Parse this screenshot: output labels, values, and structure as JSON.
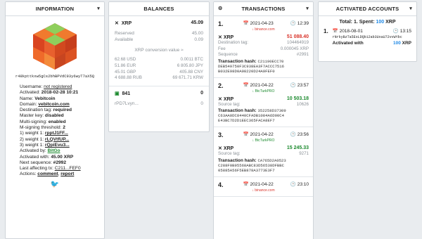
{
  "info": {
    "title": "INFORMATION",
    "address": "r48kpttkxw5gCs2bhBPVdC93y6wyT7aX5Q",
    "lines": [
      {
        "label": "Username: ",
        "value": "not registered",
        "style": "underline"
      },
      {
        "label": "Activated: ",
        "value": "2018-02-28 10:21",
        "style": "bold"
      },
      {
        "label": "Name: ",
        "value": "Vebitcoin",
        "style": "bold"
      },
      {
        "label": "Domain: ",
        "value": "vebitcoin.com",
        "style": "bold-underline"
      },
      {
        "label": "Destination tag: ",
        "value": "required",
        "style": "bold"
      },
      {
        "label": "Master key: ",
        "value": "disabled",
        "style": "bold"
      },
      {
        "label": "Multi-signing: ",
        "value": "enabled",
        "style": "bold"
      },
      {
        "label": "M-signing threshold: ",
        "value": "2",
        "style": "bold"
      },
      {
        "label": "1) weight 1: ",
        "value": "rpptJ1FF...",
        "style": "bold-underline"
      },
      {
        "label": "2) weight 1: ",
        "value": "rLQVtfUP...",
        "style": "bold-underline"
      },
      {
        "label": "3) weight 1: ",
        "value": "rQpiEvu3...",
        "style": "bold-underline"
      },
      {
        "label": "Activated by: ",
        "value": "BitGo",
        "style": "green-underline"
      },
      {
        "label": "Activated with: ",
        "value": "45.00 XRP",
        "style": "bold"
      },
      {
        "label": "Next sequence: ",
        "value": "#2992",
        "style": "bold"
      },
      {
        "label": "Last affecting tx: ",
        "value": "C211...FEF0",
        "style": "underline"
      }
    ],
    "actions_label": "Actions: ",
    "actions": [
      "comment",
      "report"
    ]
  },
  "balances": {
    "title": "BALANCES",
    "xrp_label": "XRP",
    "xrp_value": "45.09",
    "reserved_label": "Reserved",
    "reserved_value": "45.00",
    "available_label": "Available",
    "available_value": "0.09",
    "conversion_title": "XRP conversion value ≈",
    "conversion": [
      "62.68 USD",
      "0.0011 BTC",
      "51.86 EUR",
      "6 805.80 JPY",
      "45.01 GBP",
      "405.88 CNY",
      "4 688.88 RUB",
      "69 671.71 KRW"
    ],
    "token_count": "841",
    "token_value": "0",
    "token_addr": "rPD7Lvyn...",
    "token_addr_value": "0"
  },
  "transactions": {
    "title": "TRANSACTIONS",
    "items": [
      {
        "num": "1.",
        "date": "2021-04-23",
        "time": "12:39",
        "source": "binance.com",
        "source_color": "#d9342b",
        "currency": "XRP",
        "amount": "51 088.40",
        "amount_color": "#d9342b",
        "fields": [
          [
            "Destination tag:",
            "104464919"
          ],
          [
            "Fee",
            "0.000045 XRP"
          ],
          [
            "Sequence",
            "#2991"
          ]
        ],
        "hash_label": "Transaction hash:",
        "hash": [
          "C21190ECC70",
          "DEB549750F3C938EA3F7ACCC7516",
          "B032E98D0A98220D24A9FEF0"
        ]
      },
      {
        "num": "2.",
        "date": "2021-04-22",
        "time": "23:57",
        "source": "BtcTurkPRO",
        "source_color": "#1c8a2e",
        "currency": "XRP",
        "amount": "10 503.18",
        "amount_color": "#1c8a2e",
        "fields": [
          [
            "Source tag:",
            "10626"
          ]
        ],
        "hash_label": "Transaction hash:",
        "hash": [
          "352258D37309",
          "C63AA0DC8440CFADB1084A6D90C4",
          "E43BC7D2D1EEC365FACA8EF7"
        ]
      },
      {
        "num": "3.",
        "date": "2021-04-22",
        "time": "23:56",
        "source": "BtcTurkPRO",
        "source_color": "#1c8a2e",
        "currency": "XRP",
        "amount": "15 245.33",
        "amount_color": "#1c8a2e",
        "fields": [
          [
            "Source tag:",
            "9271"
          ]
        ],
        "hash_label": "Transaction hash:",
        "hash": [
          "CA765D2A0523",
          "C288F0B95568ABC83D56538DFBBC",
          "05885A56F5EB878A3773E3F7"
        ]
      },
      {
        "num": "4.",
        "date": "2021-04-22",
        "time": "23:10",
        "source": "binance.com",
        "source_color": "#d9342b",
        "currency": "",
        "amount": "",
        "amount_color": "#d9342b",
        "fields": [],
        "hash_label": "",
        "hash": []
      }
    ]
  },
  "activated": {
    "title": "ACTIVATED ACCOUNTS",
    "total_label": "Total: ",
    "total_value": "1",
    "spent_label": ". Spent: ",
    "spent_value": "100",
    "spent_unit": " XRP",
    "items": [
      {
        "num": "1.",
        "date": "2018-08-01",
        "time": "13:15",
        "address": "rNrkyBzTa5EoLDQb12ab3UxaU72vvWYbc",
        "with_label": "Activated with",
        "with_value": "100",
        "with_unit": " XRP"
      }
    ]
  },
  "colors": {
    "green": "#1c8a2e",
    "red": "#d9342b",
    "blue": "#1e88e5",
    "twitter": "#1da1f2"
  }
}
